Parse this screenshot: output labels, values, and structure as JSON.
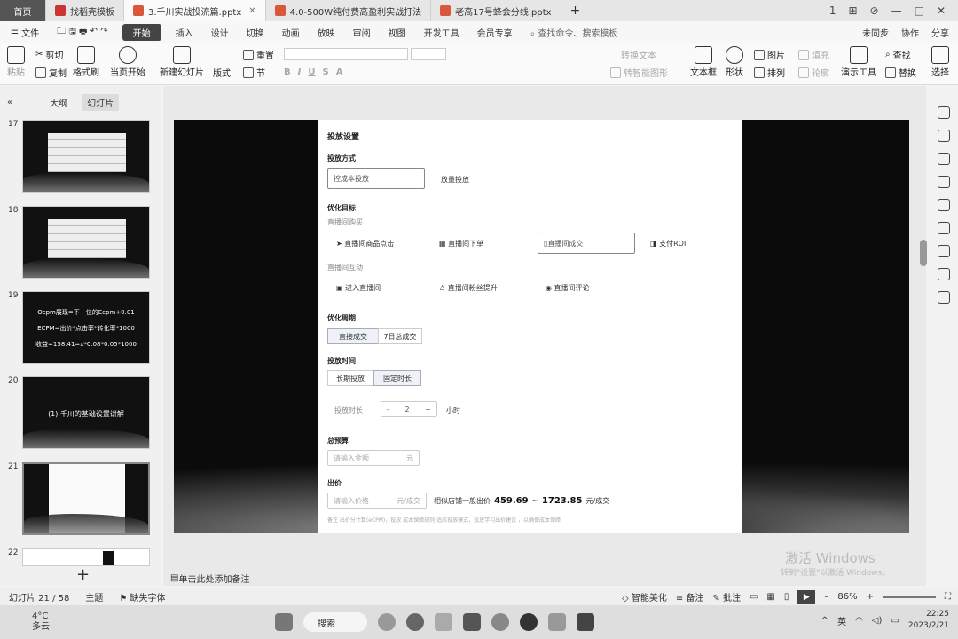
{
  "titlebar": {
    "tabs": [
      {
        "label": "首页",
        "kind": "home"
      },
      {
        "label": "找稻壳模板",
        "kind": "normal"
      },
      {
        "label": "3.千川实战投流篇.pptx",
        "kind": "active"
      },
      {
        "label": "4.0-500W纯付费高盈利实战打法",
        "kind": "normal"
      },
      {
        "label": "老高17号蜂会分线.pptx",
        "kind": "normal"
      }
    ],
    "add_label": "+",
    "controls": [
      "1",
      "⊞",
      "⊘",
      "—",
      "□",
      "✕"
    ]
  },
  "menubar": {
    "file": "文件",
    "items": [
      "开始",
      "插入",
      "设计",
      "切换",
      "动画",
      "放映",
      "审阅",
      "视图",
      "开发工具",
      "会员专享"
    ],
    "search": "查找命令、搜索模板",
    "right": [
      "未同步",
      "协作",
      "分享"
    ]
  },
  "ribbon": {
    "paste": "粘贴",
    "cut": "剪切",
    "copy": "复制",
    "format_painter": "格式刷",
    "from_current": "当页开始",
    "new_slide": "新建幻灯片",
    "layout": "版式",
    "section": "节",
    "reset": "重置",
    "convert_text": "转换文本",
    "smart_shape": "转智能图形",
    "textbox": "文本框",
    "shape": "形状",
    "picture": "图片",
    "arrange": "排列",
    "fill": "填充",
    "outline": "轮廓",
    "presenter_tools": "演示工具",
    "replace": "替换",
    "select": "选择",
    "find": "查找"
  },
  "leftpanel": {
    "tabs": [
      "大纲",
      "幻灯片"
    ],
    "slides": [
      {
        "num": "17",
        "kind": "table"
      },
      {
        "num": "18",
        "kind": "table"
      },
      {
        "num": "19",
        "kind": "text",
        "lines": [
          "Ocpm展现=下一位的Ecpm+0.01",
          "ECPM=出价*点击率*转化率*1000",
          "收益=158.41=x*0.08*0.05*1000"
        ]
      },
      {
        "num": "20",
        "kind": "title",
        "lines": [
          "(1).千川的基础设置讲解"
        ]
      },
      {
        "num": "21",
        "kind": "current"
      },
      {
        "num": "22",
        "kind": "partial"
      }
    ]
  },
  "slide": {
    "title": "投放设置",
    "method_label": "投放方式",
    "method_option1": "控成本投放",
    "method_option2": "放量投放",
    "goal_label": "优化目标",
    "group1": "直播间购买",
    "goal1": "直播间商品点击",
    "goal2": "直播间下单",
    "goal3": "直播间成交",
    "goal4": "支付ROI",
    "group2": "直播间互动",
    "goal5": "进入直播间",
    "goal6": "直播间粉丝提升",
    "goal7": "直播间评论",
    "period_label": "优化周期",
    "period1": "直接成交",
    "period2": "7日总成交",
    "time_label": "投放时间",
    "time1": "长期投放",
    "time2": "固定时长",
    "duration_label": "投放时长",
    "duration_minus": "-",
    "duration_value": "2",
    "duration_plus": "+",
    "duration_unit": "小时",
    "budget_label": "总预算",
    "budget_placeholder": "请输入金额",
    "budget_unit": "元",
    "bid_label": "出价",
    "bid_placeholder": "请输入价格",
    "bid_unit": "元/成交",
    "bid_hint": "相似店铺一般出价",
    "bid_range": "459.69 ~ 1723.85",
    "bid_range_unit": "元/成交",
    "note": "备注 出价分计算(eCPM)，投放 成本保障规则 适应投放模式，投放学习出价建议 ，以确保成本保障"
  },
  "notes": {
    "placeholder": "单击此处添加备注"
  },
  "watermark": {
    "line1": "激活 Windows",
    "line2": "转到\"设置\"以激活 Windows。"
  },
  "statusbar": {
    "slide_count": "幻灯片 21 / 58",
    "theme": "主题",
    "missing_font": "缺失字体",
    "smart_beautify": "智能美化",
    "notes": "备注",
    "comments": "批注",
    "zoom": "86%"
  },
  "taskbar": {
    "temp": "4°C",
    "weather": "多云",
    "search": "搜索",
    "lang": "英",
    "time": "22:25",
    "date": "2023/2/21"
  }
}
